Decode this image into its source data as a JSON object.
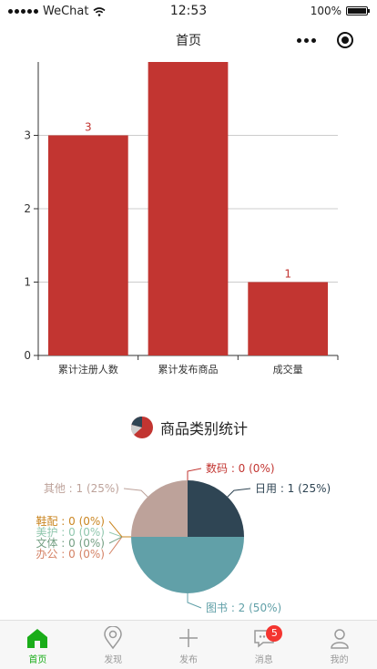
{
  "status_bar": {
    "carrier": "WeChat",
    "time": "12:53",
    "battery": "100%",
    "battery_level": 1.0
  },
  "nav": {
    "title": "首页"
  },
  "chart_data": [
    {
      "type": "bar",
      "categories": [
        "累计注册人数",
        "累计发布商品",
        "成交量"
      ],
      "values": [
        3,
        4,
        1
      ],
      "data_labels": [
        "3",
        "",
        "1"
      ],
      "ylim": [
        0,
        4
      ],
      "yticks": [
        0,
        1,
        2,
        3
      ],
      "grid": true,
      "color": "#c23531"
    },
    {
      "type": "pie",
      "title": "商品类别统计",
      "slices": [
        {
          "name": "日用",
          "value": 1,
          "label": "日用 : 1 (25%)",
          "color": "#2f4554"
        },
        {
          "name": "图书",
          "value": 2,
          "label": "图书 : 2 (50%)",
          "color": "#61a0a8"
        },
        {
          "name": "办公",
          "value": 0,
          "label": "办公 : 0 (0%)",
          "color": "#d48265"
        },
        {
          "name": "文体",
          "value": 0,
          "label": "文体 : 0 (0%)",
          "color": "#749f83"
        },
        {
          "name": "美护",
          "value": 0,
          "label": "美护 : 0 (0%)",
          "color": "#91c7ae"
        },
        {
          "name": "鞋配",
          "value": 0,
          "label": "鞋配 : 0 (0%)",
          "color": "#ca8622"
        },
        {
          "name": "其他",
          "value": 1,
          "label": "其他 : 1 (25%)",
          "color": "#bda29a"
        },
        {
          "name": "数码",
          "value": 0,
          "label": "数码 : 0 (0%)",
          "color": "#c23531"
        }
      ]
    }
  ],
  "tabs": [
    {
      "label": "首页",
      "icon": "home-icon",
      "active": true
    },
    {
      "label": "发现",
      "icon": "location-icon"
    },
    {
      "label": "发布",
      "icon": "plus-icon"
    },
    {
      "label": "消息",
      "icon": "message-icon",
      "badge": "5"
    },
    {
      "label": "我的",
      "icon": "user-icon"
    }
  ],
  "colors": {
    "accent": "#1aad19",
    "bar": "#c23531",
    "badge": "#f43530"
  }
}
